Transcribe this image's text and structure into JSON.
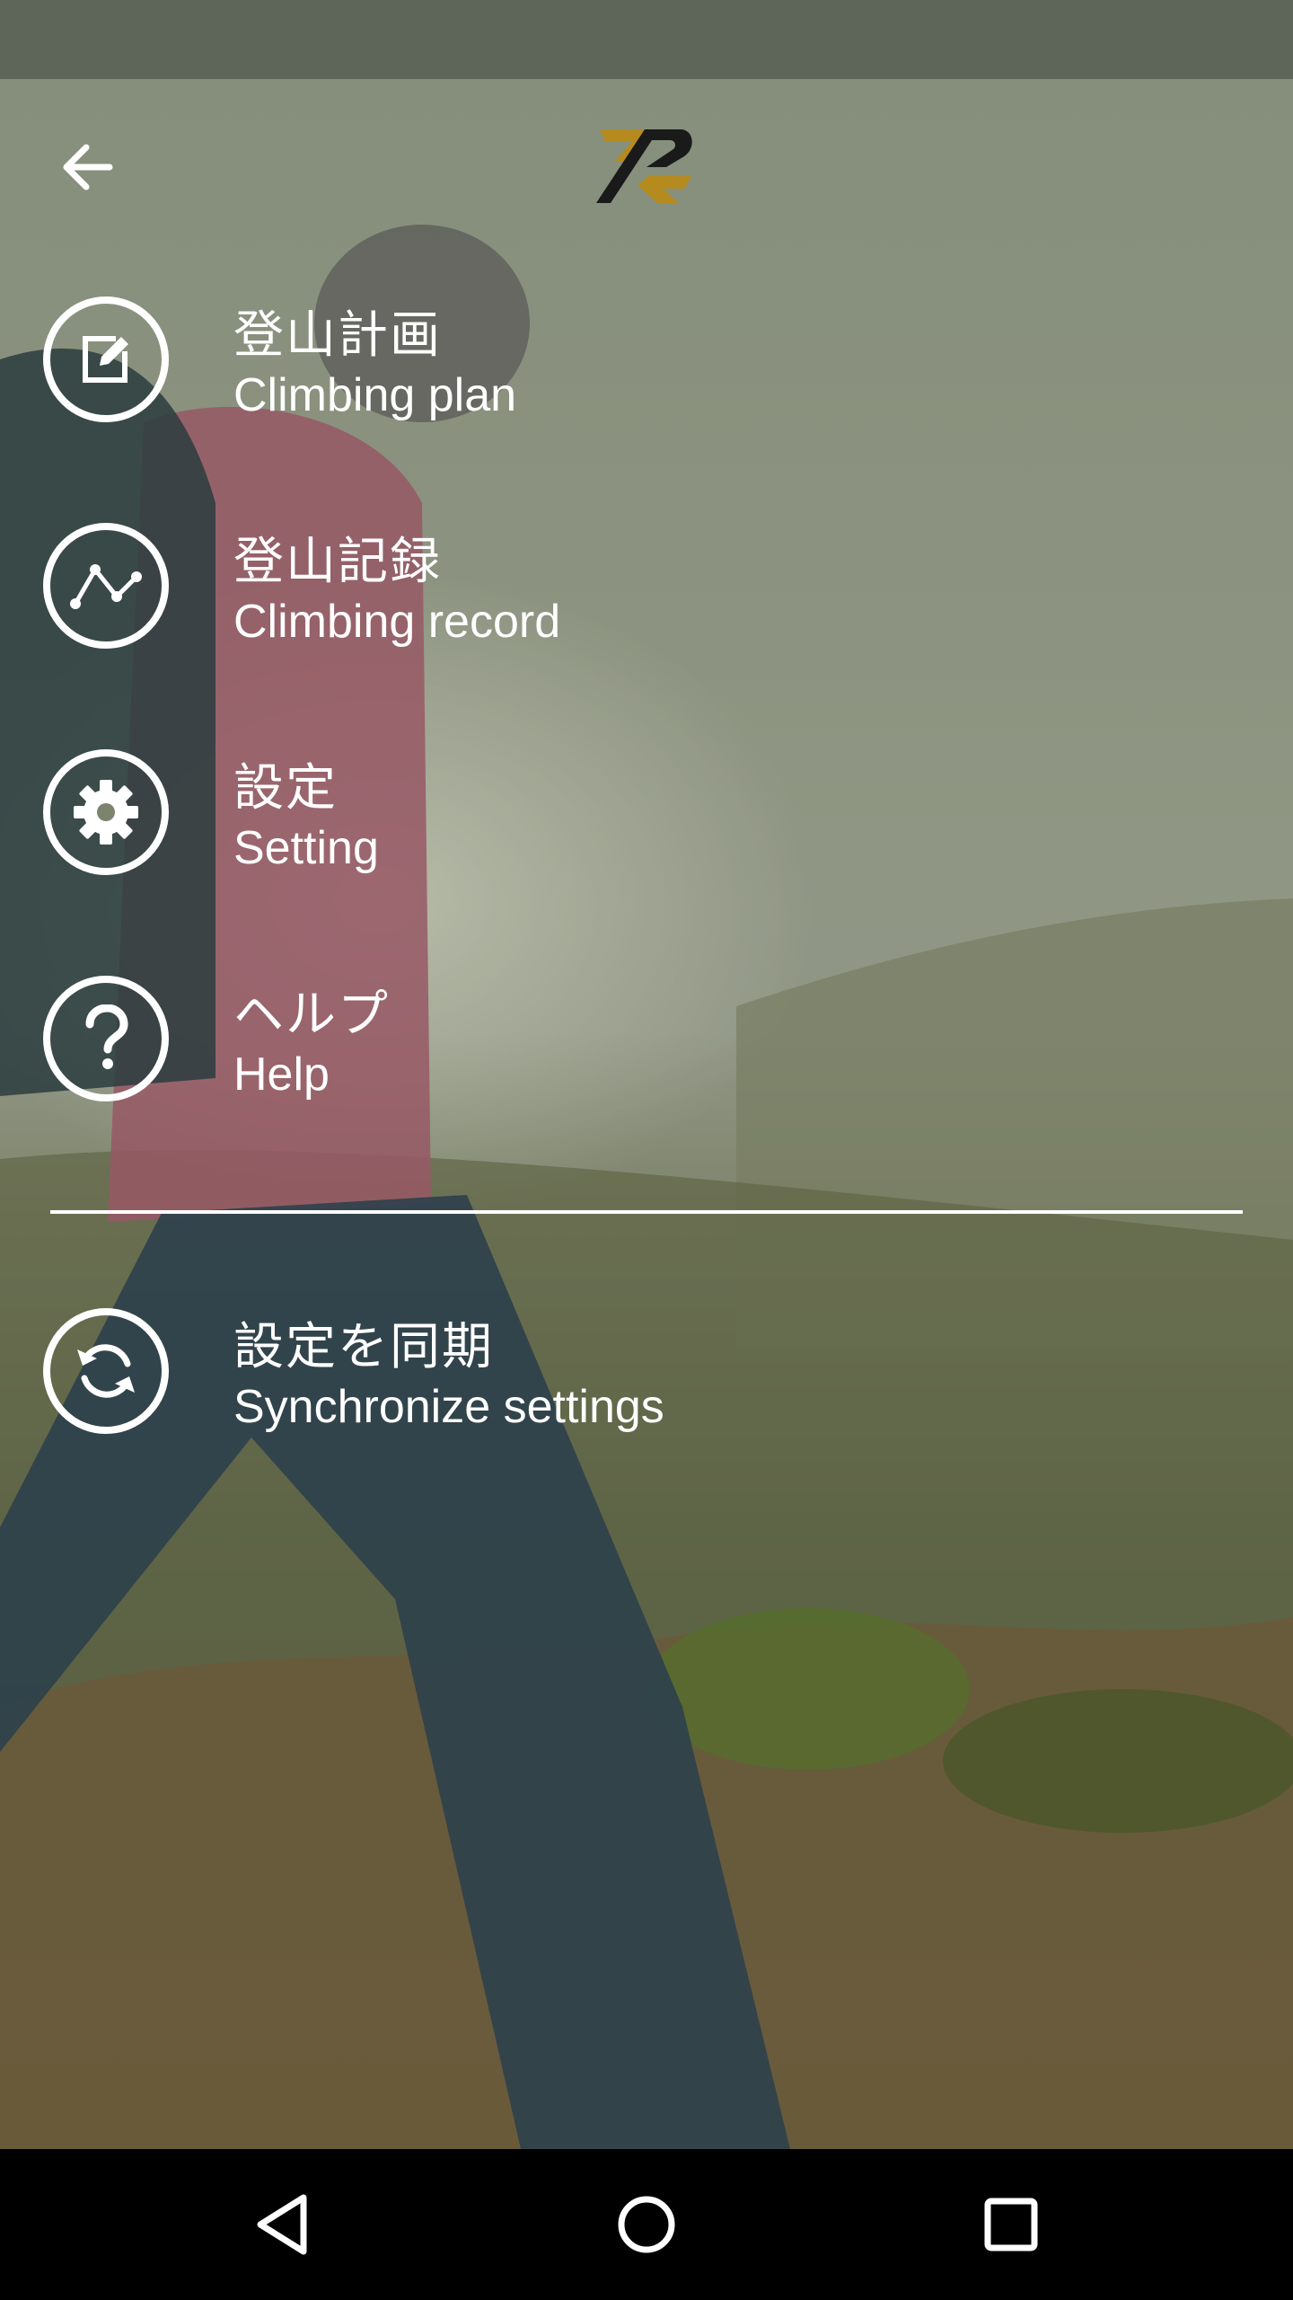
{
  "header": {
    "back_icon": "arrow-left-icon",
    "logo": "app-logo"
  },
  "menu": {
    "items": [
      {
        "jp": "登山計画",
        "en": "Climbing plan",
        "icon": "edit-icon"
      },
      {
        "jp": "登山記録",
        "en": "Climbing record",
        "icon": "route-icon"
      },
      {
        "jp": "設定",
        "en": "Setting",
        "icon": "gear-icon"
      },
      {
        "jp": "ヘルプ",
        "en": "Help",
        "icon": "help-icon"
      }
    ],
    "sync": {
      "jp": "設定を同期",
      "en": "Synchronize settings",
      "icon": "sync-icon"
    }
  },
  "navbar": {
    "back": "nav-back-icon",
    "home": "nav-home-icon",
    "recents": "nav-recents-icon"
  },
  "colors": {
    "text": "#ffffff",
    "logo_dark": "#1a1a1a",
    "logo_gold": "#b58a1f",
    "navbar": "#000000"
  }
}
